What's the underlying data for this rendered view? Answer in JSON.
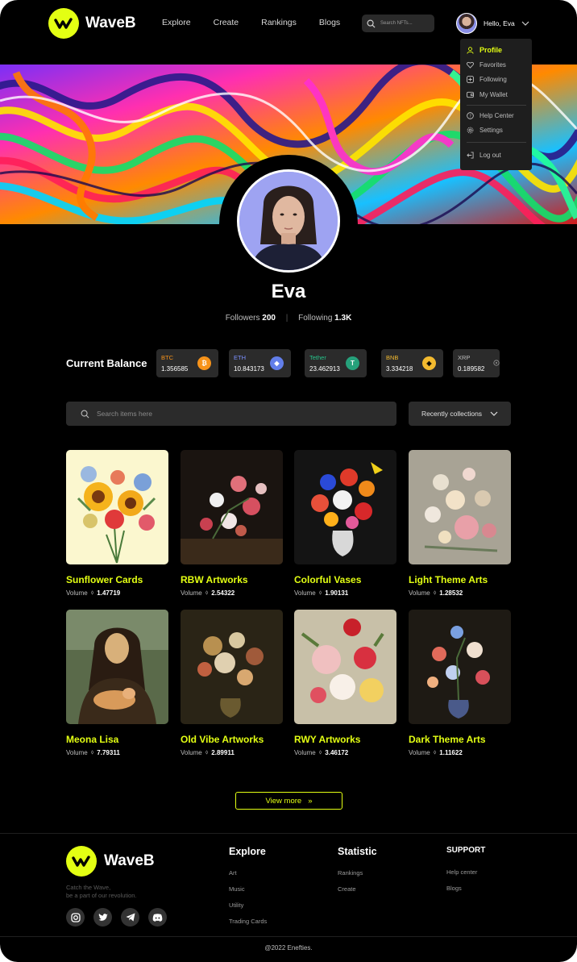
{
  "brand": {
    "name": "WaveB",
    "accent": "#e3ff13"
  },
  "nav": {
    "items": [
      "Explore",
      "Create",
      "Rankings",
      "Blogs"
    ]
  },
  "search_top": {
    "placeholder": "Search NFTs..."
  },
  "user": {
    "greeting": "Hello, Eva"
  },
  "dropdown": {
    "items": [
      {
        "label": "Profile",
        "icon": "user-icon",
        "active": true
      },
      {
        "label": "Favorites",
        "icon": "heart-icon"
      },
      {
        "label": "Following",
        "icon": "plus-square-icon"
      },
      {
        "label": "My Wallet",
        "icon": "wallet-icon"
      },
      {
        "label": "Help Center",
        "icon": "help-icon"
      },
      {
        "label": "Settings",
        "icon": "gear-icon"
      },
      {
        "label": "Log out",
        "icon": "logout-icon"
      }
    ]
  },
  "profile": {
    "name": "Eva",
    "followers_label": "Followers",
    "followers": "200",
    "following_label": "Following",
    "following": "1.3K"
  },
  "balance": {
    "label": "Current Balance",
    "coins": [
      {
        "name": "BTC",
        "value": "1.356585",
        "color": "#f7931a",
        "icon": "bitcoin-icon"
      },
      {
        "name": "ETH",
        "value": "10.843173",
        "color": "#627eea",
        "icon": "ethereum-icon"
      },
      {
        "name": "Tether",
        "value": "23.462913",
        "color": "#26a17b",
        "icon": "tether-icon"
      },
      {
        "name": "BNB",
        "value": "3.334218",
        "color": "#f3ba2f",
        "icon": "bnb-icon"
      },
      {
        "name": "XRP",
        "value": "0.189582",
        "color": "#bdbdbd",
        "icon": "xrp-icon"
      }
    ]
  },
  "items_search": {
    "placeholder": "Search items here"
  },
  "sort": {
    "label": "Recently collections"
  },
  "volume_label": "Volume",
  "collections": [
    {
      "title": "Sunflower Cards",
      "volume": "1.47719"
    },
    {
      "title": "RBW Artworks",
      "volume": "2.54322"
    },
    {
      "title": "Colorful Vases",
      "volume": "1.90131"
    },
    {
      "title": "Light Theme Arts",
      "volume": "1.28532"
    },
    {
      "title": "Meona Lisa",
      "volume": "7.79311"
    },
    {
      "title": "Old Vibe Artworks",
      "volume": "2.89911"
    },
    {
      "title": "RWY Artworks",
      "volume": "3.46172"
    },
    {
      "title": "Dark Theme Arts",
      "volume": "1.11622"
    }
  ],
  "view_more": {
    "label": "View more"
  },
  "footer": {
    "tagline_1": "Catch the Wave,",
    "tagline_2": "be a part of our revolution.",
    "socials": [
      "instagram-icon",
      "twitter-icon",
      "telegram-icon",
      "discord-icon"
    ],
    "explore": {
      "title": "Explore",
      "links": [
        "Art",
        "Music",
        "Utility",
        "Trading Cards"
      ]
    },
    "statistic": {
      "title": "Statistic",
      "links": [
        "Rankings",
        "Create"
      ]
    },
    "support": {
      "title": "SUPPORT",
      "links": [
        "Help center",
        "Blogs"
      ]
    },
    "copyright": "@2022 Enefties."
  }
}
